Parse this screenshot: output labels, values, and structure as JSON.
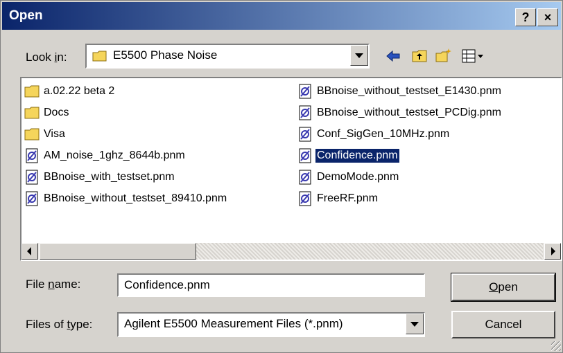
{
  "window": {
    "title": "Open",
    "help_label": "?",
    "close_label": "×"
  },
  "lookin": {
    "label_pre": "Look ",
    "label_accel": "i",
    "label_post": "n:",
    "value": "E5500 Phase Noise"
  },
  "toolbar": {
    "icons": [
      "back-arrow-icon",
      "up-folder-icon",
      "new-folder-icon",
      "view-menu-icon"
    ]
  },
  "files": {
    "col1": [
      {
        "name": "a.02.22 beta 2",
        "type": "folder"
      },
      {
        "name": "Docs",
        "type": "folder"
      },
      {
        "name": "Visa",
        "type": "folder"
      },
      {
        "name": "AM_noise_1ghz_8644b.pnm",
        "type": "pnm"
      },
      {
        "name": "BBnoise_with_testset.pnm",
        "type": "pnm"
      },
      {
        "name": "BBnoise_without_testset_89410.pnm",
        "type": "pnm"
      }
    ],
    "col2": [
      {
        "name": "BBnoise_without_testset_E1430.pnm",
        "type": "pnm"
      },
      {
        "name": "BBnoise_without_testset_PCDig.pnm",
        "type": "pnm"
      },
      {
        "name": "Conf_SigGen_10MHz.pnm",
        "type": "pnm"
      },
      {
        "name": "Confidence.pnm",
        "type": "pnm",
        "selected": true
      },
      {
        "name": "DemoMode.pnm",
        "type": "pnm"
      },
      {
        "name": "FreeRF.pnm",
        "type": "pnm"
      }
    ]
  },
  "filename": {
    "label_pre": "File ",
    "label_accel": "n",
    "label_post": "ame:",
    "value": "Confidence.pnm"
  },
  "filetype": {
    "label_pre": "Files of ",
    "label_accel": "t",
    "label_post": "ype:",
    "value": "Agilent E5500 Measurement Files (*.pnm)"
  },
  "buttons": {
    "open_accel": "O",
    "open_rest": "pen",
    "cancel": "Cancel"
  },
  "colors": {
    "title_start": "#0a246a",
    "title_end": "#a6caf0",
    "selection": "#0a246a",
    "face": "#d6d3ce",
    "pnm_icon": "#3a3ab0",
    "folder": "#f5d55b"
  }
}
